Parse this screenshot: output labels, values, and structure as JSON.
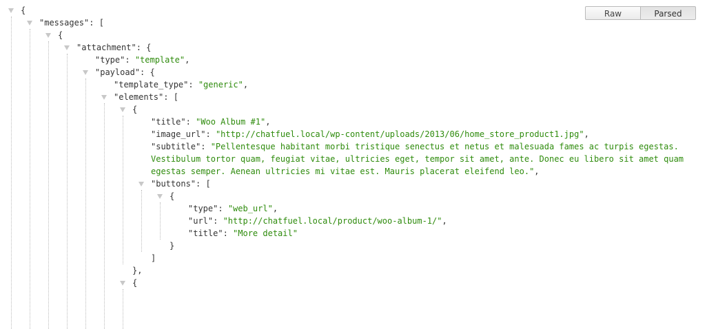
{
  "toolbar": {
    "raw_label": "Raw",
    "parsed_label": "Parsed",
    "active": "Parsed"
  },
  "json_lines": [
    {
      "depth": 0,
      "toggle": true,
      "parts": [
        [
          "p",
          "{"
        ]
      ]
    },
    {
      "depth": 1,
      "toggle": true,
      "parts": [
        [
          "k",
          "\"messages\""
        ],
        [
          "p",
          ": ["
        ]
      ]
    },
    {
      "depth": 2,
      "toggle": true,
      "parts": [
        [
          "p",
          "{"
        ]
      ]
    },
    {
      "depth": 3,
      "toggle": true,
      "parts": [
        [
          "k",
          "\"attachment\""
        ],
        [
          "p",
          ": {"
        ]
      ]
    },
    {
      "depth": 4,
      "toggle": false,
      "parts": [
        [
          "k",
          "\"type\""
        ],
        [
          "p",
          ": "
        ],
        [
          "s",
          "\"template\""
        ],
        [
          "p",
          ","
        ]
      ]
    },
    {
      "depth": 4,
      "toggle": true,
      "parts": [
        [
          "k",
          "\"payload\""
        ],
        [
          "p",
          ": {"
        ]
      ]
    },
    {
      "depth": 5,
      "toggle": false,
      "parts": [
        [
          "k",
          "\"template_type\""
        ],
        [
          "p",
          ": "
        ],
        [
          "s",
          "\"generic\""
        ],
        [
          "p",
          ","
        ]
      ]
    },
    {
      "depth": 5,
      "toggle": true,
      "parts": [
        [
          "k",
          "\"elements\""
        ],
        [
          "p",
          ": ["
        ]
      ]
    },
    {
      "depth": 6,
      "toggle": true,
      "parts": [
        [
          "p",
          "{"
        ]
      ]
    },
    {
      "depth": 7,
      "toggle": false,
      "parts": [
        [
          "k",
          "\"title\""
        ],
        [
          "p",
          ": "
        ],
        [
          "s",
          "\"Woo Album #1\""
        ],
        [
          "p",
          ","
        ]
      ]
    },
    {
      "depth": 7,
      "toggle": false,
      "parts": [
        [
          "k",
          "\"image_url\""
        ],
        [
          "p",
          ": "
        ],
        [
          "s",
          "\"http://chatfuel.local/wp-content/uploads/2013/06/home_store_product1.jpg\""
        ],
        [
          "p",
          ","
        ]
      ]
    },
    {
      "depth": 7,
      "toggle": false,
      "parts": [
        [
          "k",
          "\"subtitle\""
        ],
        [
          "p",
          ": "
        ],
        [
          "s",
          "\"Pellentesque habitant morbi tristique senectus et netus et malesuada fames ac turpis egestas."
        ]
      ]
    },
    {
      "depth": 7,
      "toggle": false,
      "parts": [
        [
          "s",
          "Vestibulum tortor quam, feugiat vitae, ultricies eget, tempor sit amet, ante. Donec eu libero sit amet quam"
        ]
      ]
    },
    {
      "depth": 7,
      "toggle": false,
      "parts": [
        [
          "s",
          "egestas semper. Aenean ultricies mi vitae est. Mauris placerat eleifend leo.\""
        ],
        [
          "p",
          ","
        ]
      ]
    },
    {
      "depth": 7,
      "toggle": true,
      "parts": [
        [
          "k",
          "\"buttons\""
        ],
        [
          "p",
          ": ["
        ]
      ]
    },
    {
      "depth": 8,
      "toggle": true,
      "parts": [
        [
          "p",
          "{"
        ]
      ]
    },
    {
      "depth": 9,
      "toggle": false,
      "parts": [
        [
          "k",
          "\"type\""
        ],
        [
          "p",
          ": "
        ],
        [
          "s",
          "\"web_url\""
        ],
        [
          "p",
          ","
        ]
      ]
    },
    {
      "depth": 9,
      "toggle": false,
      "parts": [
        [
          "k",
          "\"url\""
        ],
        [
          "p",
          ": "
        ],
        [
          "s",
          "\"http://chatfuel.local/product/woo-album-1/\""
        ],
        [
          "p",
          ","
        ]
      ]
    },
    {
      "depth": 9,
      "toggle": false,
      "parts": [
        [
          "k",
          "\"title\""
        ],
        [
          "p",
          ": "
        ],
        [
          "s",
          "\"More detail\""
        ]
      ]
    },
    {
      "depth": 8,
      "toggle": false,
      "parts": [
        [
          "p",
          "}"
        ]
      ]
    },
    {
      "depth": 7,
      "toggle": false,
      "parts": [
        [
          "p",
          "]"
        ]
      ]
    },
    {
      "depth": 6,
      "toggle": false,
      "parts": [
        [
          "p",
          "},"
        ]
      ]
    },
    {
      "depth": 6,
      "toggle": true,
      "parts": [
        [
          "p",
          "{"
        ]
      ]
    },
    {
      "depth": 7,
      "toggle": false,
      "parts": []
    }
  ]
}
